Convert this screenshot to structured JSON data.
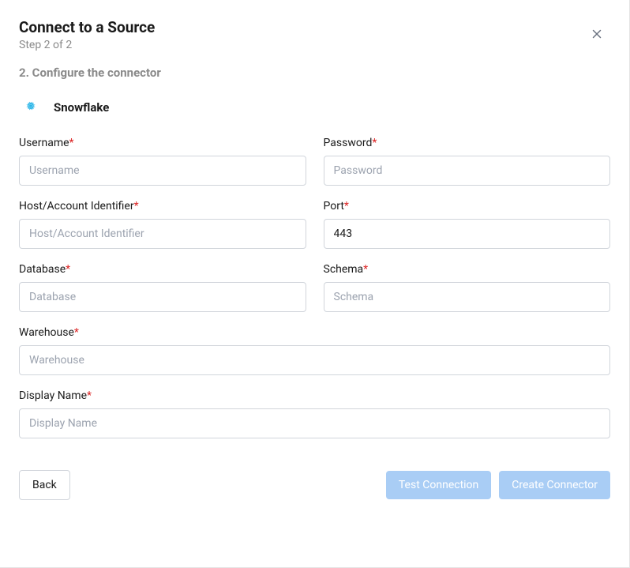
{
  "header": {
    "title": "Connect to a Source",
    "step": "Step 2 of 2"
  },
  "section": {
    "title": "2. Configure the connector"
  },
  "connector": {
    "name": "Snowflake",
    "iconName": "snowflake-icon"
  },
  "fields": {
    "username": {
      "label": "Username",
      "placeholder": "Username",
      "value": "",
      "required": true
    },
    "password": {
      "label": "Password",
      "placeholder": "Password",
      "value": "",
      "required": true
    },
    "host": {
      "label": "Host/Account Identifier",
      "placeholder": "Host/Account Identifier",
      "value": "",
      "required": true
    },
    "port": {
      "label": "Port",
      "placeholder": "",
      "value": "443",
      "required": true
    },
    "database": {
      "label": "Database",
      "placeholder": "Database",
      "value": "",
      "required": true
    },
    "schema": {
      "label": "Schema",
      "placeholder": "Schema",
      "value": "",
      "required": true
    },
    "warehouse": {
      "label": "Warehouse",
      "placeholder": "Warehouse",
      "value": "",
      "required": true
    },
    "displayName": {
      "label": "Display Name",
      "placeholder": "Display Name",
      "value": "",
      "required": true
    }
  },
  "buttons": {
    "back": "Back",
    "testConnection": "Test Connection",
    "createConnector": "Create Connector"
  },
  "requiredMark": "*"
}
